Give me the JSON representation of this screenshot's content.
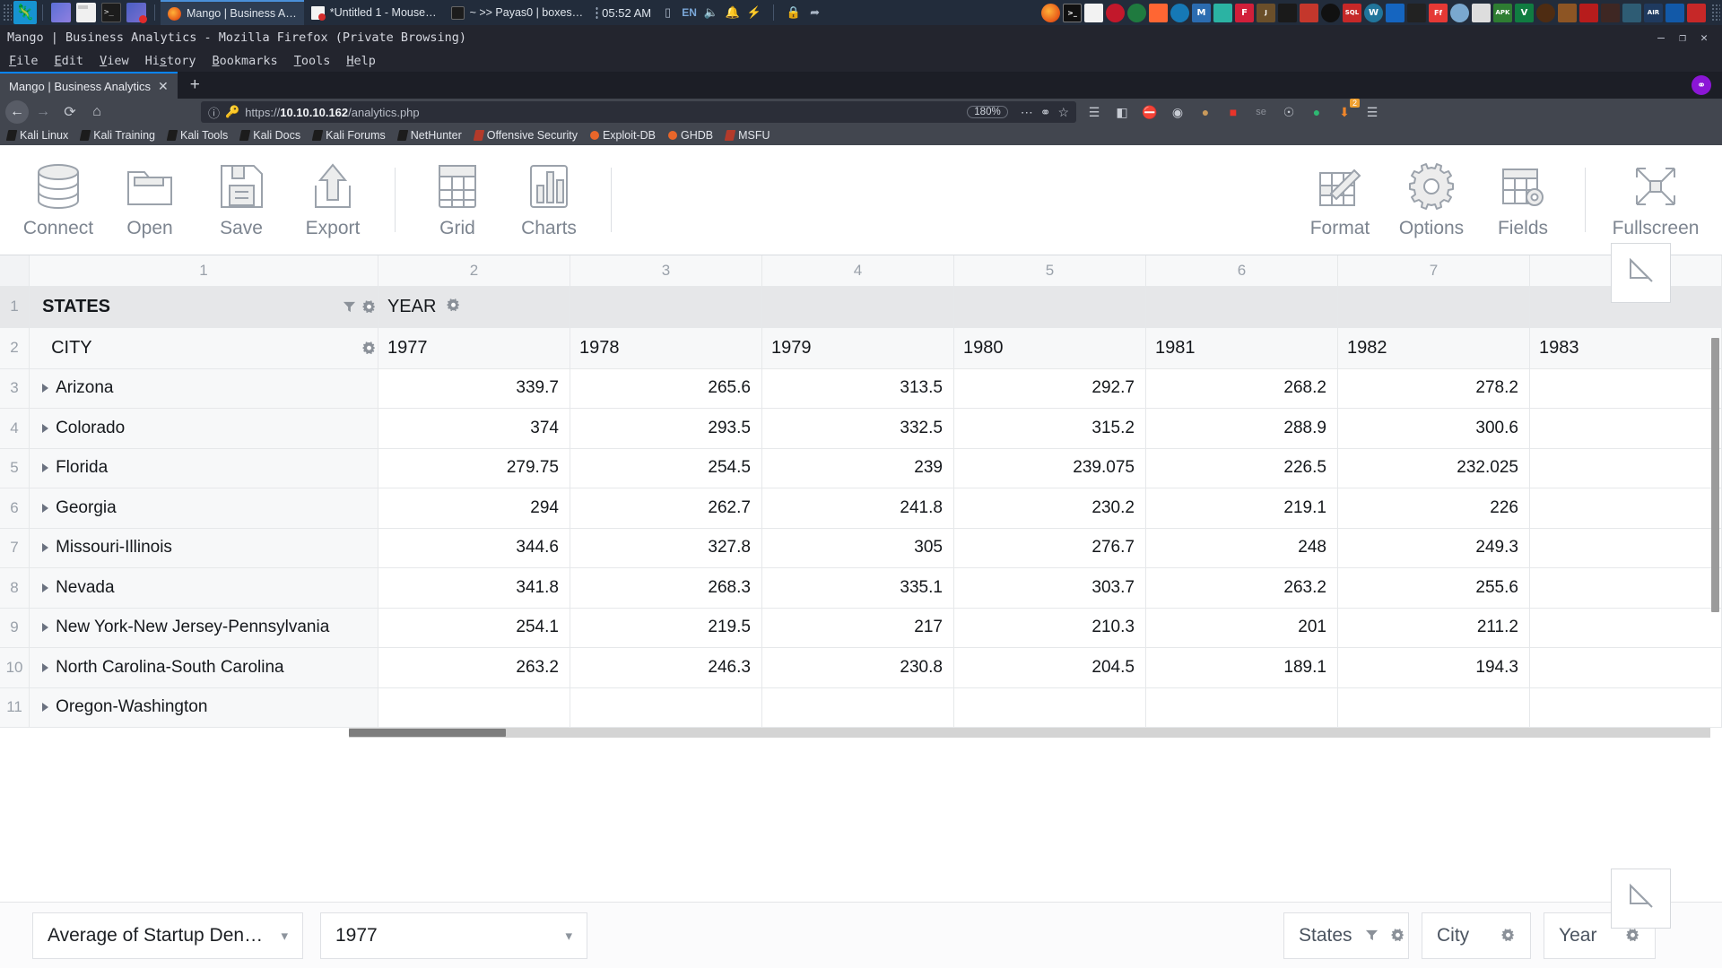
{
  "taskbar": {
    "logo_icon": "kali-dragon-icon",
    "launchers": [
      {
        "name": "files-launcher",
        "icon": "blue-square-icon"
      },
      {
        "name": "file-manager-launcher",
        "icon": "folder-icon"
      },
      {
        "name": "terminal-launcher",
        "icon": "terminal-icon"
      },
      {
        "name": "screen-recorder-launcher",
        "icon": "screen-record-icon"
      }
    ],
    "windows": [
      {
        "label": "Mango | Business A…",
        "icon": "firefox-icon",
        "active": true
      },
      {
        "label": "*Untitled 1 - Mouse…",
        "icon": "document-icon",
        "active": false
      },
      {
        "label": "~ >> Payas0 | boxes…",
        "icon": "terminal-icon",
        "active": false
      }
    ],
    "clock": "05:52 AM",
    "tray": [
      {
        "name": "display-icon",
        "glyph": "▭"
      },
      {
        "name": "keyboard-layout",
        "glyph": "EN"
      },
      {
        "name": "volume-icon",
        "glyph": "🔊"
      },
      {
        "name": "notification-bell-icon",
        "glyph": "🔔"
      },
      {
        "name": "power-icon",
        "glyph": "⚡"
      },
      {
        "name": "lock-icon",
        "glyph": "🔒"
      },
      {
        "name": "logout-icon",
        "glyph": "⮐"
      }
    ],
    "apps": [
      {
        "name": "firefox-app",
        "glyph": "",
        "color": "#e05a12"
      },
      {
        "name": "terminal-app",
        "glyph": "",
        "color": "#101010"
      },
      {
        "name": "document-app",
        "glyph": "",
        "color": "#f2f2f2"
      },
      {
        "name": "cherrytree-app",
        "glyph": "",
        "color": "#c2182b"
      },
      {
        "name": "burp-suite-app",
        "glyph": "",
        "color": "#ff6633"
      },
      {
        "name": "zap-app",
        "glyph": "",
        "color": "#d84315"
      },
      {
        "name": "wireshark-app",
        "glyph": "",
        "color": "#1679b6"
      },
      {
        "name": "metasploit-app",
        "glyph": "M",
        "color": "#2b6cb0"
      },
      {
        "name": "maltego-app",
        "glyph": "",
        "color": "#2bb3a3"
      },
      {
        "name": "faraday-app",
        "glyph": "F",
        "color": "#d11f3a"
      },
      {
        "name": "johnny-app",
        "glyph": "",
        "color": "#6b4f2a"
      },
      {
        "name": "linux-app",
        "glyph": "",
        "color": "#1a1a1a"
      },
      {
        "name": "hydra-app",
        "glyph": "",
        "color": "#c4372c"
      },
      {
        "name": "proxy-app",
        "glyph": "",
        "color": "#111111"
      },
      {
        "name": "sqlmap-app",
        "glyph": "",
        "color": "#c62828"
      },
      {
        "name": "wordpress-app",
        "glyph": "W",
        "color": "#21759b"
      },
      {
        "name": "zap2-app",
        "glyph": "",
        "color": "#1565c0"
      },
      {
        "name": "hashcat-app",
        "glyph": "",
        "color": "#222222"
      },
      {
        "name": "ffuf-app",
        "glyph": "Ff",
        "color": "#e53935"
      },
      {
        "name": "alien-app",
        "glyph": "",
        "color": "#7aa8cf"
      },
      {
        "name": "dolphin-app",
        "glyph": "",
        "color": "#dddddd"
      },
      {
        "name": "apktool-app",
        "glyph": "",
        "color": "#2e7d32"
      },
      {
        "name": "vim-app",
        "glyph": "V",
        "color": "#107c41"
      },
      {
        "name": "spider-app",
        "glyph": "",
        "color": "#4e2c12"
      },
      {
        "name": "recon-app",
        "glyph": "",
        "color": "#8d5524"
      },
      {
        "name": "nikto-app",
        "glyph": "",
        "color": "#b71c1c"
      },
      {
        "name": "doberman-app",
        "glyph": "",
        "color": "#3e2723"
      },
      {
        "name": "landscape-app",
        "glyph": "",
        "color": "#2e5c74"
      },
      {
        "name": "air-app",
        "glyph": "",
        "color": "#1f3a5f"
      },
      {
        "name": "blue-arrow-app",
        "glyph": "",
        "color": "#1259a8"
      },
      {
        "name": "thermometer-app",
        "glyph": "",
        "color": "#c62828"
      }
    ]
  },
  "firefox": {
    "window_title": "Mango | Business Analytics - Mozilla Firefox (Private Browsing)",
    "window_controls": [
      "–",
      "❐",
      "✕"
    ],
    "menus": [
      "File",
      "Edit",
      "View",
      "History",
      "Bookmarks",
      "Tools",
      "Help"
    ],
    "tab": {
      "title": "Mango | Business Analytics",
      "close": "✕"
    },
    "new_tab": "+",
    "url_scheme": "https://",
    "url_host": "10.10.10.162",
    "url_path": "/analytics.php",
    "zoom_level": "180%",
    "bookmarks": [
      "Kali Linux",
      "Kali Training",
      "Kali Tools",
      "Kali Docs",
      "Kali Forums",
      "NetHunter",
      "Offensive Security",
      "Exploit-DB",
      "GHDB",
      "MSFU"
    ],
    "toolbar_icons": [
      "library-icon",
      "sidebar-icon",
      "noscript-icon",
      "cookie-icon",
      "badger-icon",
      "ublock-icon",
      "selenium-icon",
      "account-icon",
      "bitwarden-icon",
      "downloads-icon",
      "menu-icon"
    ],
    "download_badge": "2"
  },
  "app": {
    "ribbon": {
      "left_items": [
        {
          "label": "Connect",
          "icon": "database-icon"
        },
        {
          "label": "Open",
          "icon": "folder-open-icon"
        },
        {
          "label": "Save",
          "icon": "floppy-disk-icon"
        },
        {
          "label": "Export",
          "icon": "upload-icon"
        }
      ],
      "view_items": [
        {
          "label": "Grid",
          "icon": "table-grid-icon"
        },
        {
          "label": "Charts",
          "icon": "bar-chart-icon"
        }
      ],
      "right_items": [
        {
          "label": "Format",
          "icon": "format-table-pencil-icon"
        },
        {
          "label": "Options",
          "icon": "gear-icon"
        },
        {
          "label": "Fields",
          "icon": "table-gear-icon"
        }
      ],
      "fullscreen_item": {
        "label": "Fullscreen",
        "icon": "fullscreen-arrows-icon"
      }
    },
    "grid": {
      "column_numbers": [
        "1",
        "2",
        "3",
        "4",
        "5",
        "6",
        "7"
      ],
      "header_row_1": {
        "row_number": "1",
        "label": "STATES",
        "second_label": "YEAR"
      },
      "header_row_2": {
        "row_number": "2",
        "label": "CITY"
      },
      "year_columns": [
        "1977",
        "1978",
        "1979",
        "1980",
        "1981",
        "1982",
        "1983"
      ],
      "rows": [
        {
          "n": "3",
          "state": "Arizona",
          "values": [
            "339.7",
            "265.6",
            "313.5",
            "292.7",
            "268.2",
            "278.2",
            ""
          ]
        },
        {
          "n": "4",
          "state": "Colorado",
          "values": [
            "374",
            "293.5",
            "332.5",
            "315.2",
            "288.9",
            "300.6",
            ""
          ]
        },
        {
          "n": "5",
          "state": "Florida",
          "values": [
            "279.75",
            "254.5",
            "239",
            "239.075",
            "226.5",
            "232.025",
            ""
          ]
        },
        {
          "n": "6",
          "state": "Georgia",
          "values": [
            "294",
            "262.7",
            "241.8",
            "230.2",
            "219.1",
            "226",
            ""
          ]
        },
        {
          "n": "7",
          "state": "Missouri-Illinois",
          "values": [
            "344.6",
            "327.8",
            "305",
            "276.7",
            "248",
            "249.3",
            ""
          ]
        },
        {
          "n": "8",
          "state": "Nevada",
          "values": [
            "341.8",
            "268.3",
            "335.1",
            "303.7",
            "263.2",
            "255.6",
            ""
          ]
        },
        {
          "n": "9",
          "state": "New York-New Jersey-Pennsylvania",
          "values": [
            "254.1",
            "219.5",
            "217",
            "210.3",
            "201",
            "211.2",
            ""
          ]
        },
        {
          "n": "10",
          "state": "North Carolina-South Carolina",
          "values": [
            "263.2",
            "246.3",
            "230.8",
            "204.5",
            "189.1",
            "194.3",
            ""
          ]
        },
        {
          "n": "11",
          "state": "Oregon-Washington",
          "values": [
            "",
            "",
            "",
            "",
            "",
            "",
            ""
          ]
        }
      ]
    },
    "footer": {
      "measure_select": "Average of Startup Den…",
      "year_select": "1977",
      "fields": [
        {
          "label": "States",
          "has_filter": true
        },
        {
          "label": "City",
          "has_filter": false
        },
        {
          "label": "Year",
          "has_filter": false
        }
      ]
    },
    "panels": {
      "collapse_icon": "collapse-arrow-icon"
    },
    "colors": {
      "header_bg": "#e6e7e9",
      "row_alt_bg": "#f7f8f9",
      "text": "#15181c",
      "muted": "#9aa1aa",
      "accent": "#0a84ff"
    }
  }
}
